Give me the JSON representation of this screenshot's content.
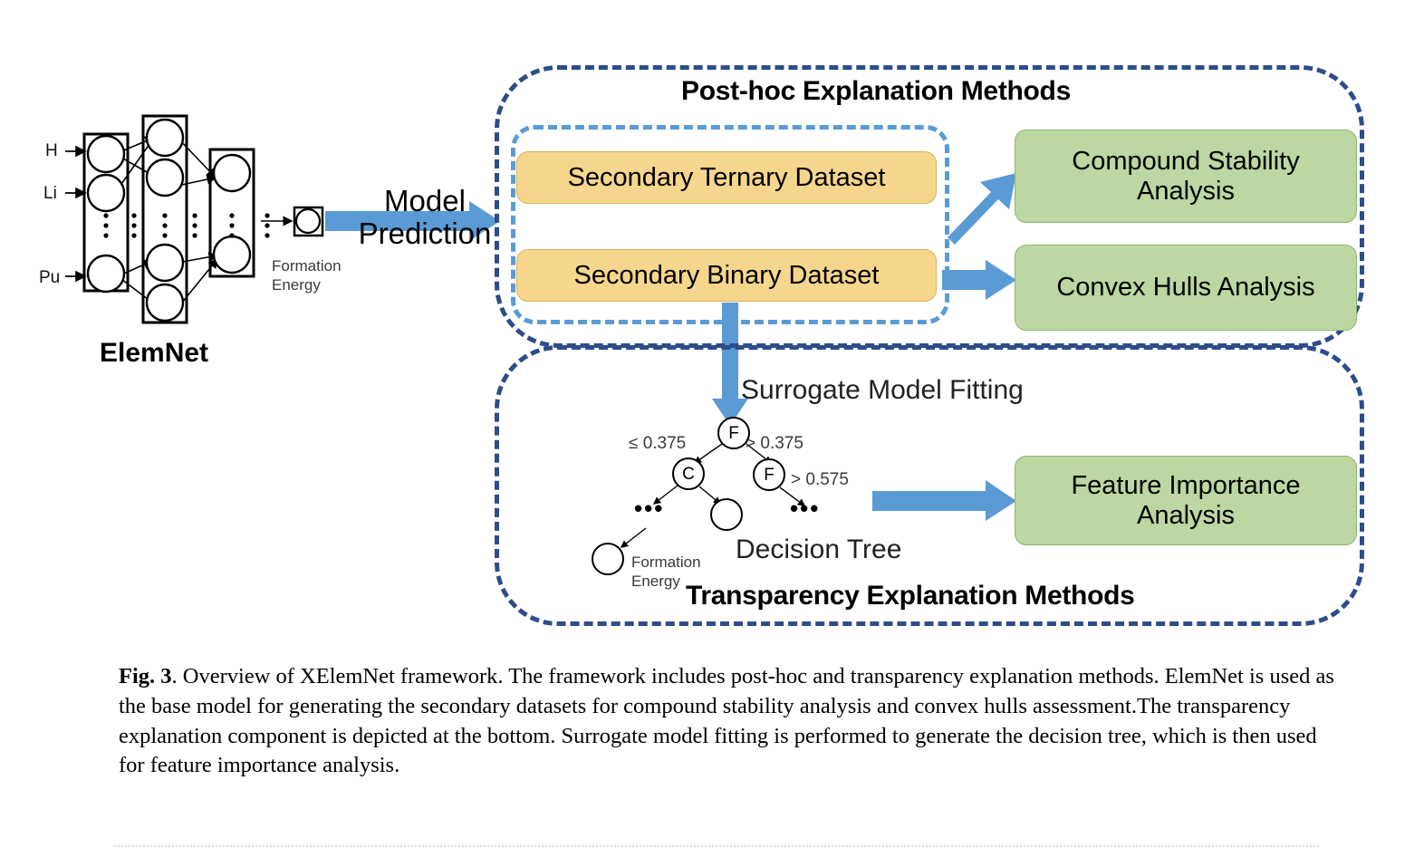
{
  "figure": {
    "caption_label": "Fig. 3",
    "caption_text": ".  Overview of XElemNet framework. The framework includes post-hoc and transparency explanation methods. ElemNet is used as the base model for generating the secondary datasets for compound stability analysis and convex hulls assessment.The transparency explanation component is depicted at the bottom. Surrogate model fitting is performed to generate the decision tree, which is then used for feature importance analysis."
  },
  "colors": {
    "dashed_outer": "#2E4C8A",
    "dashed_inner": "#5B9BD5",
    "arrow_blue": "#5B9BD5",
    "box_yellow_fill": "#F6D68C",
    "box_yellow_border": "#D9B35F",
    "box_green_fill": "#BCD7A2",
    "box_green_border": "#8DB56E",
    "network_stroke": "#000000",
    "divider": "#d8dde5"
  },
  "elemnet": {
    "title": "ElemNet",
    "inputs": [
      "H",
      "Li",
      "Pu"
    ],
    "output_label": "Formation\nEnergy",
    "output_label_line1": "Formation",
    "output_label_line2": "Energy"
  },
  "model_prediction": {
    "line1": "Model",
    "line2": "Prediction"
  },
  "posthoc": {
    "title": "Post-hoc Explanation Methods",
    "datasets": [
      {
        "label": "Secondary Ternary Dataset"
      },
      {
        "label": "Secondary Binary Dataset"
      }
    ],
    "analyses": [
      {
        "label": "Compound Stability Analysis",
        "line1": "Compound Stability",
        "line2": "Analysis"
      },
      {
        "label": "Convex Hulls Analysis",
        "line1": "Convex Hulls Analysis",
        "line2": ""
      }
    ]
  },
  "transparency": {
    "title": "Transparency Explanation Methods",
    "surrogate_label": "Surrogate Model Fitting",
    "decision_tree_label": "Decision Tree",
    "leaf_output_line1": "Formation",
    "leaf_output_line2": "Energy",
    "analysis": {
      "label": "Feature Importance Analysis",
      "line1": "Feature Importance",
      "line2": "Analysis"
    },
    "tree": {
      "nodes": [
        {
          "id": "root",
          "text": "F"
        },
        {
          "id": "left",
          "text": "C"
        },
        {
          "id": "right",
          "text": "F"
        },
        {
          "id": "leaf-mid",
          "text": ""
        },
        {
          "id": "leaf-bottom",
          "text": ""
        }
      ],
      "edge_labels": {
        "root_left": "≤ 0.375",
        "root_right": "> 0.375",
        "right_right": "> 0.575"
      },
      "ellipsis": "•••"
    }
  }
}
